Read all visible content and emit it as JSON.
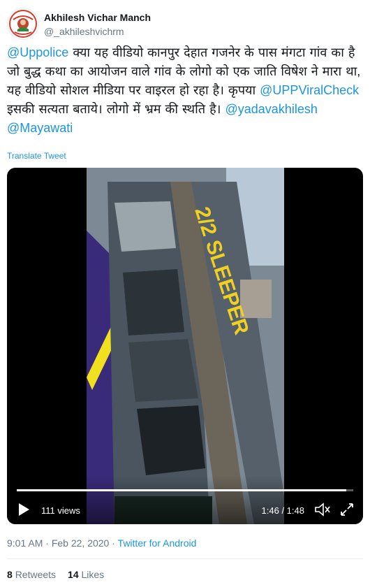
{
  "author": {
    "display_name": "Akhilesh Vichar Manch",
    "handle": "@_akhileshvichrm"
  },
  "tweet": {
    "mention_1": "@Uppolice",
    "text_1": " क्या यह वीडियो कानपुर देहात गजनेर के पास मंगटा गांव का है जो बुद्ध कथा का आयोजन वाले गांव के लोगो को एक जाति विषेश ने मारा था, यह वीडियो सोशल मीडिया पर वाइरल हो रहा है। कृपया ",
    "mention_2": "@UPPViralCheck",
    "text_2": " इसकी सत्यता बताये। लोगो में भ्रम की स्थति है। ",
    "mention_3": "@yadavakhilesh",
    "text_3": " ",
    "mention_4": "@Mayawati",
    "translate_label": "Translate Tweet"
  },
  "video": {
    "views": "111 views",
    "time": "1:46 / 1:48",
    "progress": 0.98,
    "bus_sign": "2/2 SLEEPER"
  },
  "meta": {
    "time": "9:01 AM",
    "separator_1": " · ",
    "date": "Feb 22, 2020",
    "separator_2": " · ",
    "app": "Twitter for Android"
  },
  "stats": {
    "retweets_count": "8",
    "retweets_label": "Retweets",
    "likes_count": "14",
    "likes_label": "Likes"
  },
  "icons": {
    "avatar": "avatar-logo-icon",
    "play": "play-icon",
    "volume": "volume-icon",
    "fullscreen": "fullscreen-icon"
  },
  "colors": {
    "link": "#1b95e0",
    "secondary_text": "#657786",
    "primary_text": "#14171a",
    "bus_body": "#3a2a7a",
    "bus_stripe": "#f0e020"
  }
}
